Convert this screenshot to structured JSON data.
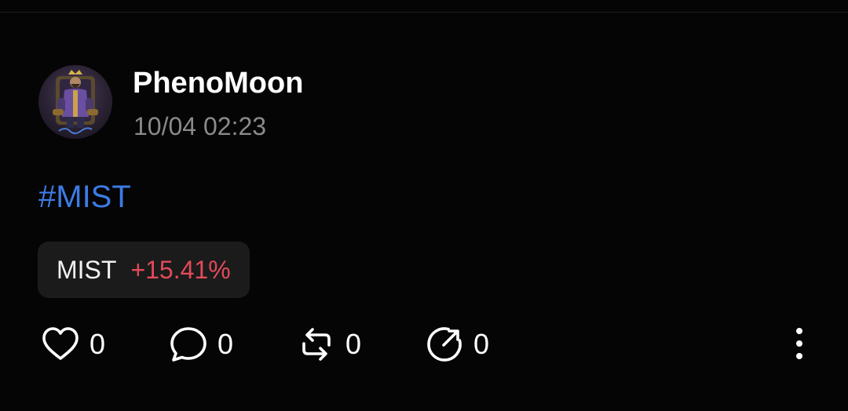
{
  "post": {
    "author": {
      "username": "PhenoMoon",
      "avatar_icon": "avatar-king-on-throne"
    },
    "timestamp": "10/04 02:23",
    "hashtag": "#MIST",
    "ticker": {
      "symbol": "MIST",
      "change": "+15.41%",
      "change_color": "#e34a5a"
    },
    "actions": {
      "like": {
        "icon": "heart-icon",
        "count": "0"
      },
      "comment": {
        "icon": "comment-bubble-icon",
        "count": "0"
      },
      "repost": {
        "icon": "repost-icon",
        "count": "0"
      },
      "share": {
        "icon": "share-arrow-icon",
        "count": "0"
      }
    },
    "more_icon": "vertical-ellipsis-icon"
  },
  "colors": {
    "background": "#050505",
    "hashtag": "#3d7be5",
    "timestamp": "#8a8a8a",
    "chip_background": "#1b1b1b"
  }
}
